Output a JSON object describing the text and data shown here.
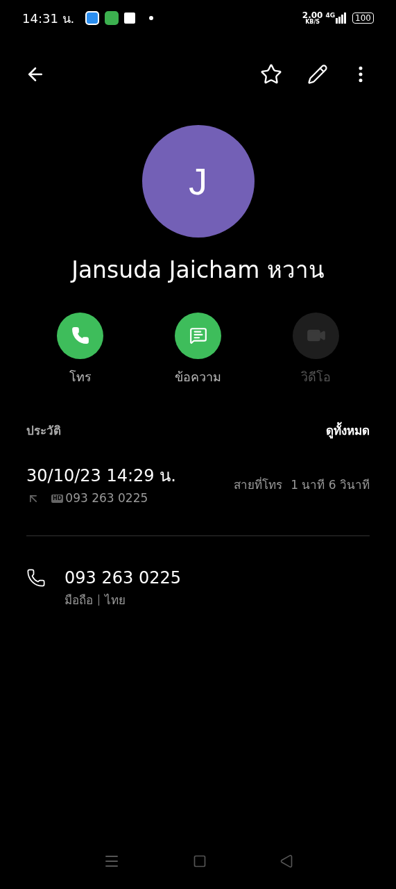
{
  "status_bar": {
    "time": "14:31 น.",
    "speed": "2.00",
    "speed_unit": "KB/S",
    "network": "4G",
    "battery": "100"
  },
  "contact": {
    "initial": "J",
    "name": "Jansuda Jaicham หวาน",
    "favorite": false
  },
  "actions": [
    {
      "kind": "call",
      "label": "โทร",
      "disabled": false
    },
    {
      "kind": "message",
      "label": "ข้อความ",
      "disabled": false
    },
    {
      "kind": "video",
      "label": "วิดีโอ",
      "disabled": true
    }
  ],
  "history": {
    "title": "ประวัติ",
    "see_all": "ดูทั้งหมด",
    "entries": [
      {
        "datetime": "30/10/23 14:29 น.",
        "number": "093 263 0225",
        "badge": "HD",
        "type": "สายที่โทร",
        "duration": "1 นาที 6 วินาที"
      }
    ]
  },
  "phones": [
    {
      "number": "093 263 0225",
      "label": "มือถือ",
      "region": "ไทย"
    }
  ]
}
